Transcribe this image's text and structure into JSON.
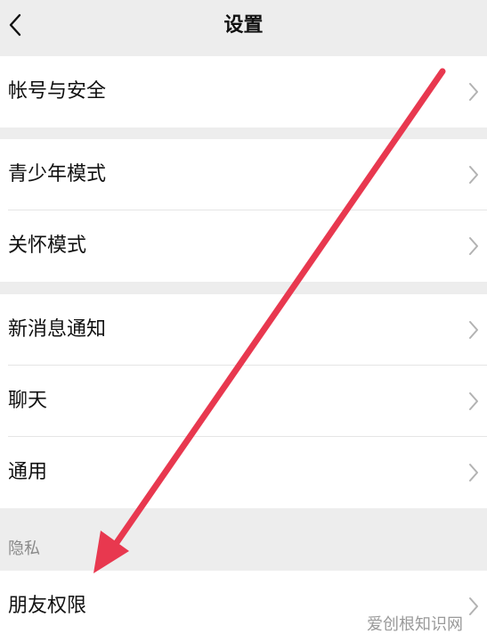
{
  "header": {
    "title": "设置",
    "back_icon": "chevron-left-icon"
  },
  "groups": [
    {
      "items": [
        {
          "label": "帐号与安全"
        }
      ]
    },
    {
      "items": [
        {
          "label": "青少年模式"
        },
        {
          "label": "关怀模式"
        }
      ]
    },
    {
      "items": [
        {
          "label": "新消息通知"
        },
        {
          "label": "聊天"
        },
        {
          "label": "通用"
        }
      ]
    }
  ],
  "privacy": {
    "section_label": "隐私",
    "items": [
      {
        "label": "朋友权限"
      }
    ]
  },
  "annotation": {
    "arrow_color": "#e8384f"
  },
  "watermark": {
    "text": "爱创根知识网"
  }
}
